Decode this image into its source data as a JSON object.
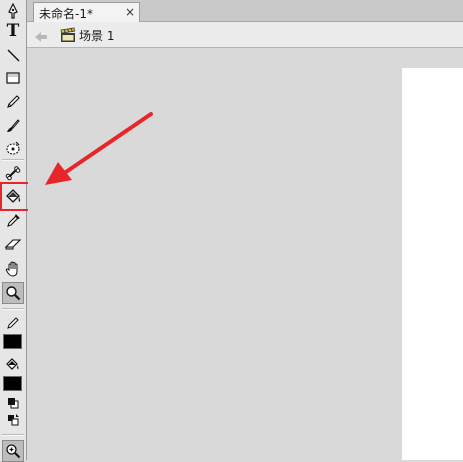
{
  "document_tab": {
    "title": "未命名-1*",
    "close_glyph": "×"
  },
  "edit_bar": {
    "back_icon": "back-arrow-icon",
    "scene_icon": "clapperboard-icon",
    "scene_name": "场景 1"
  },
  "toolbar": {
    "tools": [
      {
        "name": "subselection-tool",
        "icon": "pen-arrow-icon"
      },
      {
        "name": "text-tool",
        "icon": "text-T-icon",
        "glyph": "T"
      },
      {
        "name": "line-tool",
        "icon": "line-icon"
      },
      {
        "name": "rectangle-tool",
        "icon": "rectangle-icon"
      },
      {
        "name": "pencil-tool",
        "icon": "pencil-icon"
      },
      {
        "name": "brush-tool",
        "icon": "brush-icon"
      },
      {
        "name": "deco-tool",
        "icon": "deco-icon"
      },
      {
        "name": "bone-tool",
        "icon": "bone-icon"
      },
      {
        "name": "paint-bucket-tool",
        "icon": "paint-bucket-icon",
        "highlighted": true
      },
      {
        "name": "eyedropper-tool",
        "icon": "eyedropper-icon"
      },
      {
        "name": "eraser-tool",
        "icon": "eraser-icon"
      },
      {
        "name": "hand-tool",
        "icon": "hand-icon"
      },
      {
        "name": "zoom-tool",
        "icon": "magnifier-icon",
        "pressed": true
      }
    ],
    "stroke_color": "#000000",
    "fill_color": "#000000",
    "bottom_option": "magnifier-plus-icon"
  },
  "colors": {
    "annotation": "#e8262a",
    "pasteboard": "#d9d9d9",
    "stage": "#ffffff"
  }
}
